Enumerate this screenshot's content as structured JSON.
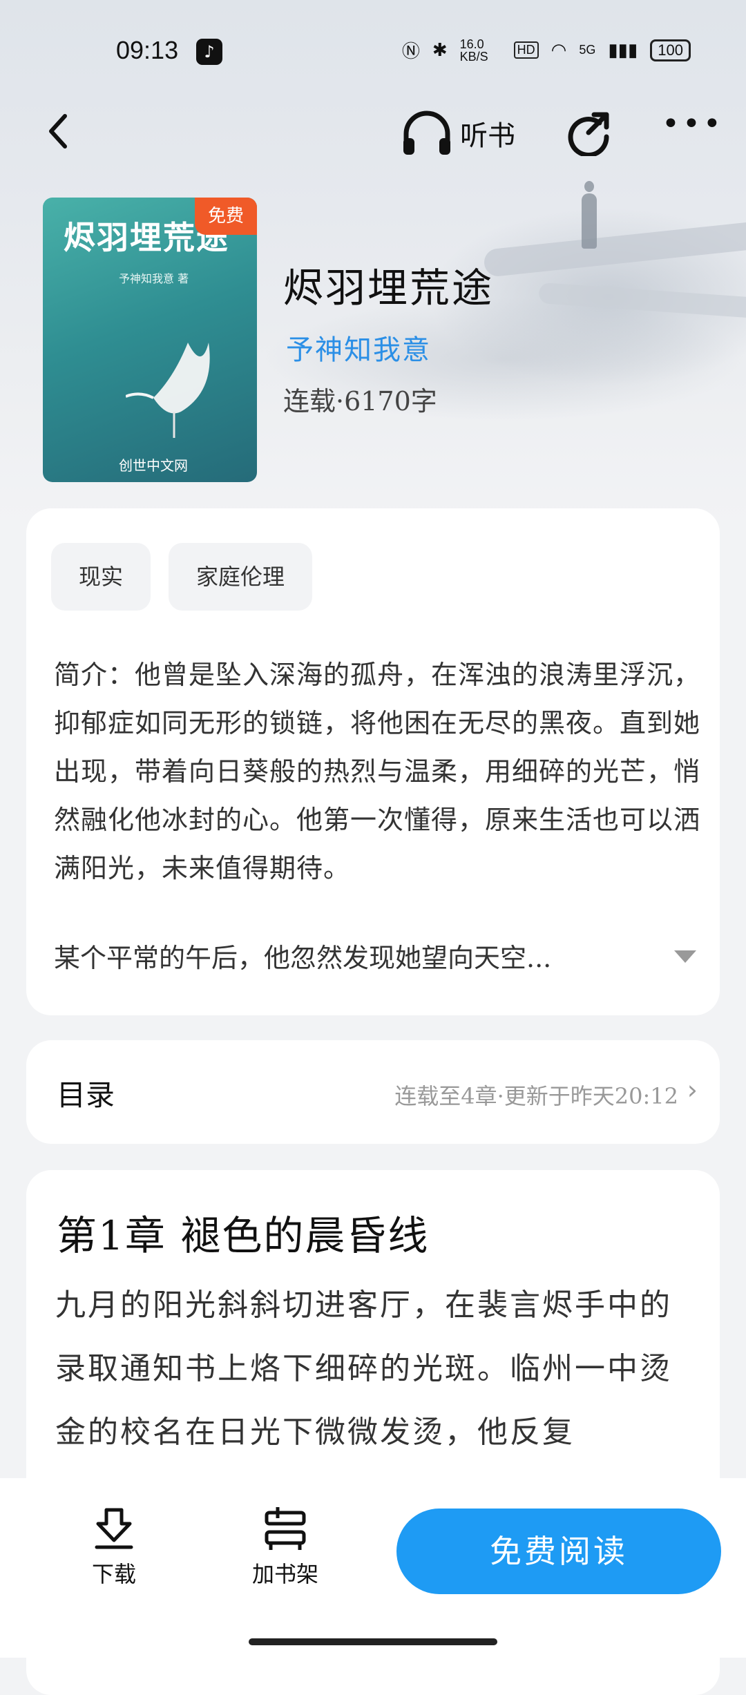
{
  "status_bar": {
    "time": "09:13",
    "network_speed": "16.0 KB/S",
    "network_type": "5G",
    "battery": "100"
  },
  "nav": {
    "listen_label": "听书"
  },
  "book": {
    "cover_title": "烬羽埋荒途",
    "cover_author": "予神知我意 著",
    "cover_publisher": "创世中文网",
    "free_badge": "免费",
    "title": "烬羽埋荒途",
    "author": "予神知我意",
    "meta": "连载·6170字"
  },
  "tags": [
    "现实",
    "家庭伦理"
  ],
  "intro": {
    "text": "简介：他曾是坠入深海的孤舟，在浑浊的浪涛里浮沉，抑郁症如同无形的锁链，将他困在无尽的黑夜。直到她出现，带着向日葵般的热烈与温柔，用细碎的光芒，悄然融化他冰封的心。他第一次懂得，原来生活也可以洒满阳光，未来值得期待。",
    "more": "某个平常的午后，他忽然发现她望向天空..."
  },
  "toc": {
    "title": "目录",
    "status": "连载至4章·更新于昨天20:12"
  },
  "chapter": {
    "title": "第1章 褪色的晨昏线",
    "body": "九月的阳光斜斜切进客厅，在裴言烬手中的录取通知书上烙下细碎的光斑。临州一中烫金的校名在日光下微微发烫，他反复"
  },
  "bottom_bar": {
    "download_label": "下载",
    "shelf_label": "加书架",
    "read_label": "免费阅读"
  },
  "colors": {
    "accent": "#1e9bf4",
    "author_link": "#2b8fe6",
    "free_badge": "#f05a28"
  }
}
